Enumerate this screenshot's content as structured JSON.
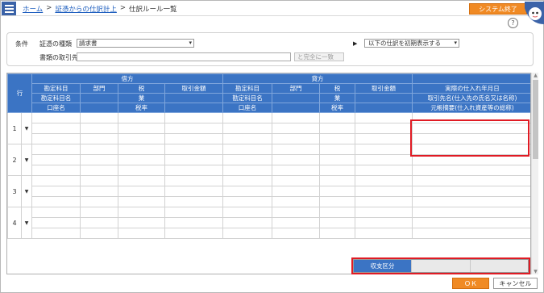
{
  "header": {
    "breadcrumb_home": "ホーム",
    "breadcrumb_sep": ">",
    "breadcrumb_voucher": "証憑からの仕訳計上",
    "breadcrumb_current": "仕訳ルール一覧",
    "exit_button": "システム終了",
    "help_glyph": "?"
  },
  "conditions": {
    "section_label": "条件",
    "voucher_type_label": "証憑の種類",
    "voucher_type_value": "請求書",
    "counterparty_label": "書類の取引先",
    "counterparty_value": "",
    "match_select": "と完全に一致",
    "initial_display_select": "以下の仕訳を初期表示する"
  },
  "table": {
    "row_header": "行",
    "debit_group": "借方",
    "credit_group": "貸方",
    "h1": [
      "勘定科目",
      "部門",
      "税",
      "取引金額",
      "勘定科目",
      "部門",
      "税",
      "取引金額",
      "実際の仕入れ年月日"
    ],
    "h2": [
      "勘定科目名",
      "業",
      "勘定科目名",
      "業",
      "取引先名(仕入先の氏名又は名称)"
    ],
    "h3": [
      "口座名",
      "税率",
      "口座名",
      "税率",
      "元帳摘要(仕入れ資産等の総称)"
    ],
    "rows": [
      {
        "num": "1"
      },
      {
        "num": "2"
      },
      {
        "num": "3"
      },
      {
        "num": "4"
      }
    ]
  },
  "footer": {
    "balance_label": "収支区分",
    "ok_button": "ＯＫ",
    "cancel_button": "キャンセル"
  },
  "colors": {
    "header_blue": "#3b74c4",
    "accent_orange": "#f08a24",
    "highlight_red": "#e01b24"
  }
}
